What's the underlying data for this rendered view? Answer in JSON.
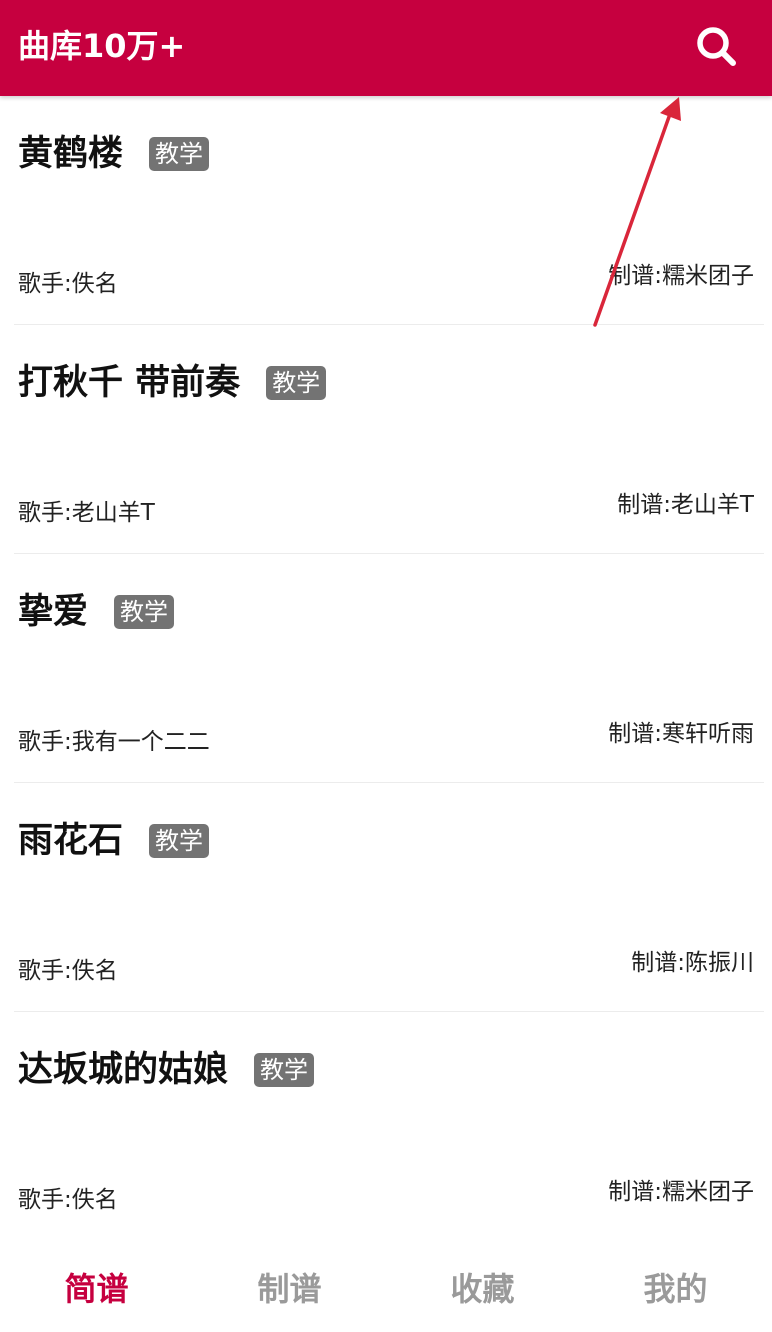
{
  "header": {
    "title": "曲库10万+",
    "search_icon": "search-icon"
  },
  "songs": [
    {
      "title": "黄鹤楼",
      "tag": "教学",
      "singer": "歌手:佚名",
      "arranger": "制谱:糯米团子"
    },
    {
      "title": "打秋千 带前奏",
      "tag": "教学",
      "singer": "歌手:老山羊T",
      "arranger": "制谱:老山羊T"
    },
    {
      "title": "挚爱",
      "tag": "教学",
      "singer": "歌手:我有一个二二",
      "arranger": "制谱:寒轩听雨"
    },
    {
      "title": "雨花石",
      "tag": "教学",
      "singer": "歌手:佚名",
      "arranger": "制谱:陈振川"
    },
    {
      "title": "达坂城的姑娘",
      "tag": "教学",
      "singer": "歌手:佚名",
      "arranger": "制谱:糯米团子"
    }
  ],
  "bottom_nav": {
    "items": [
      {
        "label": "简谱",
        "active": true
      },
      {
        "label": "制谱",
        "active": false
      },
      {
        "label": "收藏",
        "active": false
      },
      {
        "label": "我的",
        "active": false
      }
    ]
  },
  "colors": {
    "accent": "#c6003f",
    "tag_bg": "#737373",
    "nav_inactive": "#9a9a9a",
    "annotation_arrow": "#d9263a"
  }
}
